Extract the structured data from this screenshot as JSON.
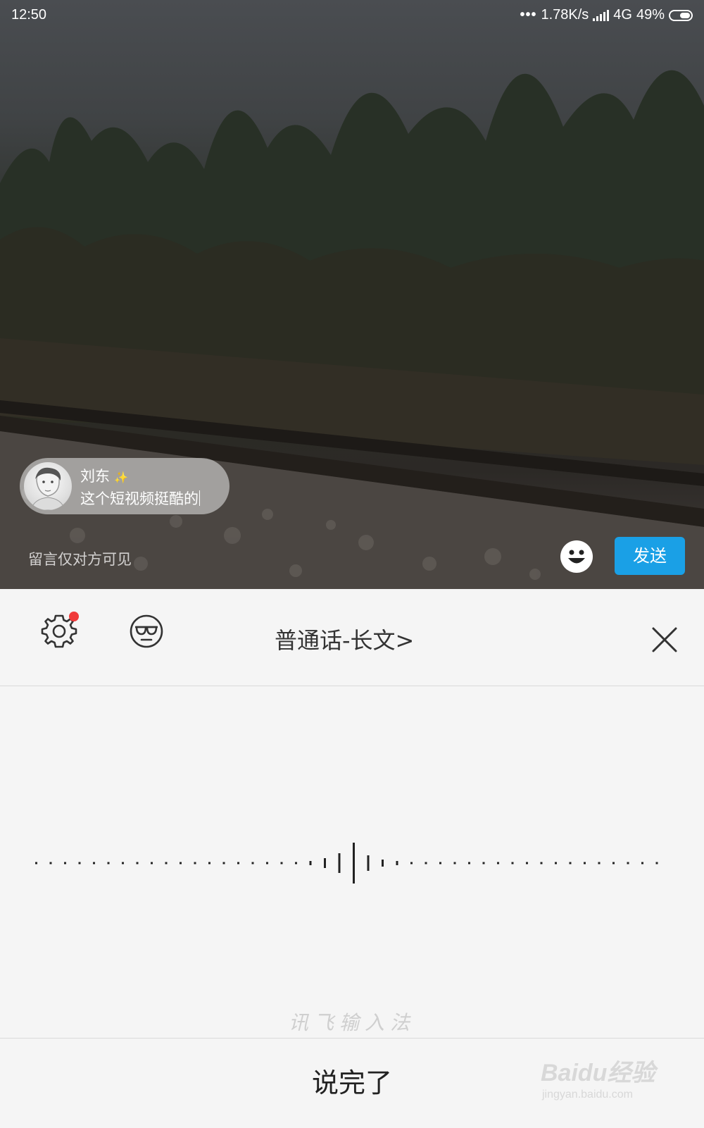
{
  "status_bar": {
    "time": "12:50",
    "dots": "•••",
    "net_speed": "1.78K/s",
    "network": "4G",
    "battery": "49%"
  },
  "comment": {
    "author": "刘东",
    "text": "这个短视频挺酷的"
  },
  "compose": {
    "hint": "留言仅对方可见",
    "send_label": "发送"
  },
  "ime": {
    "mode": "普通话-长文>",
    "brand": "讯飞输入法",
    "done_label": "说完了"
  },
  "watermark": {
    "logo": "Baidu经验",
    "site": "jingyan.baidu.com"
  },
  "colors": {
    "send_button": "#1aa0e6",
    "badge": "#f03a3a",
    "panel_bg": "#f5f5f5"
  },
  "icons": {
    "settings": "gear-icon",
    "skin": "sunglasses-face-icon",
    "close": "close-icon",
    "emoji": "smiley-icon"
  }
}
